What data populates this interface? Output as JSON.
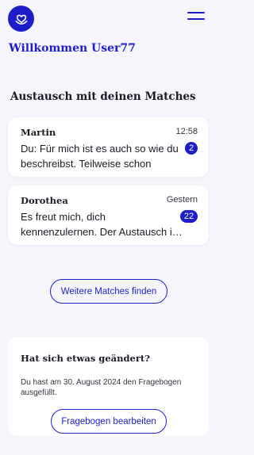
{
  "header": {
    "logo_icon": "heart-smile-logo",
    "menu_icon": "hamburger-menu-icon",
    "brand_color": "#1e1ec8"
  },
  "welcome": "Willkommen User77",
  "matches_section": {
    "title": "Austausch mit deinen Matches",
    "conversations": [
      {
        "name": "Martin",
        "time": "12:58",
        "preview": "Du: Für mich ist es auch so wie du beschreibst. Teilweise schon rech…",
        "unread": "2"
      },
      {
        "name": "Dorothea",
        "time": "Gestern",
        "preview": "Es freut mich, dich kennenzulernen. Der Austausch i…",
        "unread": "22"
      }
    ],
    "more_button": "Weitere Matches finden"
  },
  "changes_card": {
    "title": "Hat sich etwas geändert?",
    "text": "Du hast am 30. August 2024 den Fragebogen ausgefüllt.",
    "button": "Fragebogen bearbeiten"
  }
}
